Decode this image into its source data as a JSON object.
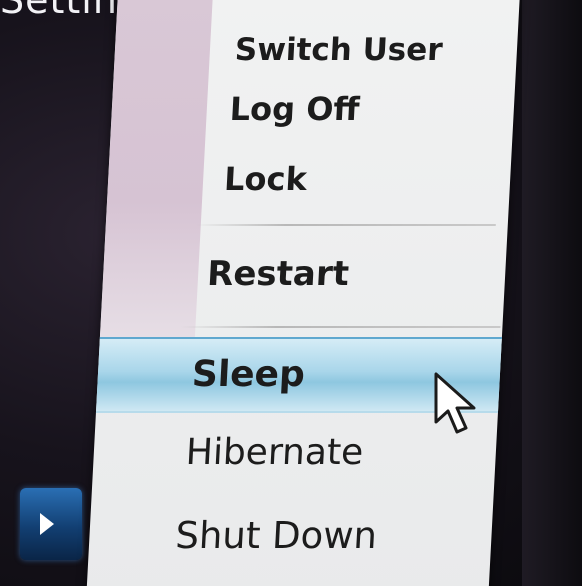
{
  "background": {
    "top_fragment_text": "Settings"
  },
  "menu": {
    "items": [
      {
        "label": "Switch User"
      },
      {
        "label": "Log Off"
      },
      {
        "label": "Lock"
      },
      {
        "label": "Restart"
      },
      {
        "label": "Sleep",
        "highlighted": true
      },
      {
        "label": "Hibernate"
      },
      {
        "label": "Shut Down"
      }
    ]
  },
  "colors": {
    "menu_background": "#ecedee",
    "gutter": "#d6c3d3",
    "highlight": "#a9d6ea",
    "arrow_button": "#123f72"
  },
  "icons": {
    "arrow_button_icon": "right-arrow-icon",
    "cursor_icon": "mouse-pointer-icon"
  }
}
